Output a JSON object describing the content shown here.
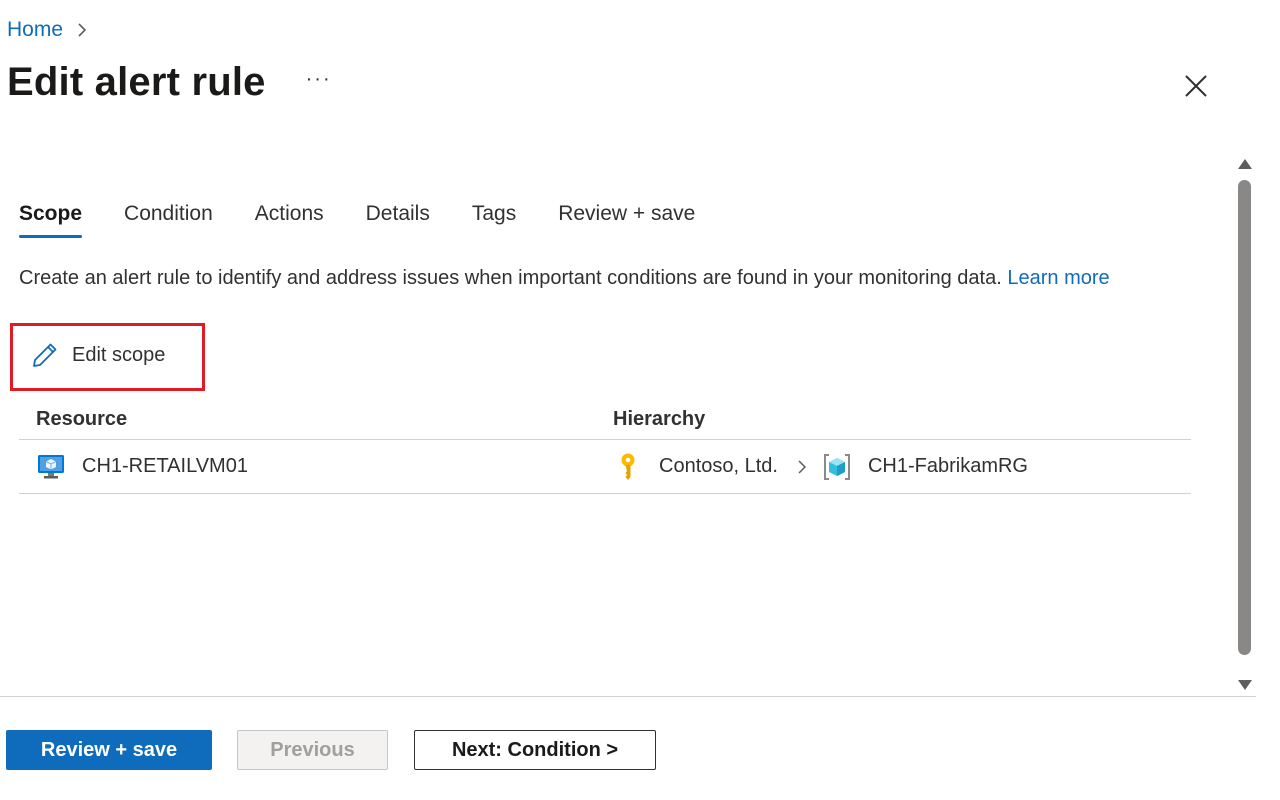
{
  "breadcrumb": {
    "home": "Home"
  },
  "header": {
    "title": "Edit alert rule",
    "more": "···"
  },
  "tabs": [
    {
      "label": "Scope",
      "active": true
    },
    {
      "label": "Condition",
      "active": false
    },
    {
      "label": "Actions",
      "active": false
    },
    {
      "label": "Details",
      "active": false
    },
    {
      "label": "Tags",
      "active": false
    },
    {
      "label": "Review + save",
      "active": false
    }
  ],
  "description": {
    "text": "Create an alert rule to identify and address issues when important conditions are found in your monitoring data.",
    "link": "Learn more"
  },
  "edit_scope": {
    "label": "Edit scope",
    "icon": "pencil-icon"
  },
  "table": {
    "headers": [
      "Resource",
      "Hierarchy"
    ],
    "rows": [
      {
        "resource": "CH1-RETAILVM01",
        "resource_icon": "virtual-machine-icon",
        "hierarchy": [
          {
            "label": "Contoso, Ltd.",
            "icon": "subscription-key-icon"
          },
          {
            "label": "CH1-FabrikamRG",
            "icon": "resource-group-icon"
          }
        ]
      }
    ]
  },
  "footer": {
    "review_save": "Review + save",
    "previous": "Previous",
    "next": "Next: Condition >"
  },
  "colors": {
    "accent": "#0f6cbd",
    "highlight_border": "#e01b24"
  }
}
